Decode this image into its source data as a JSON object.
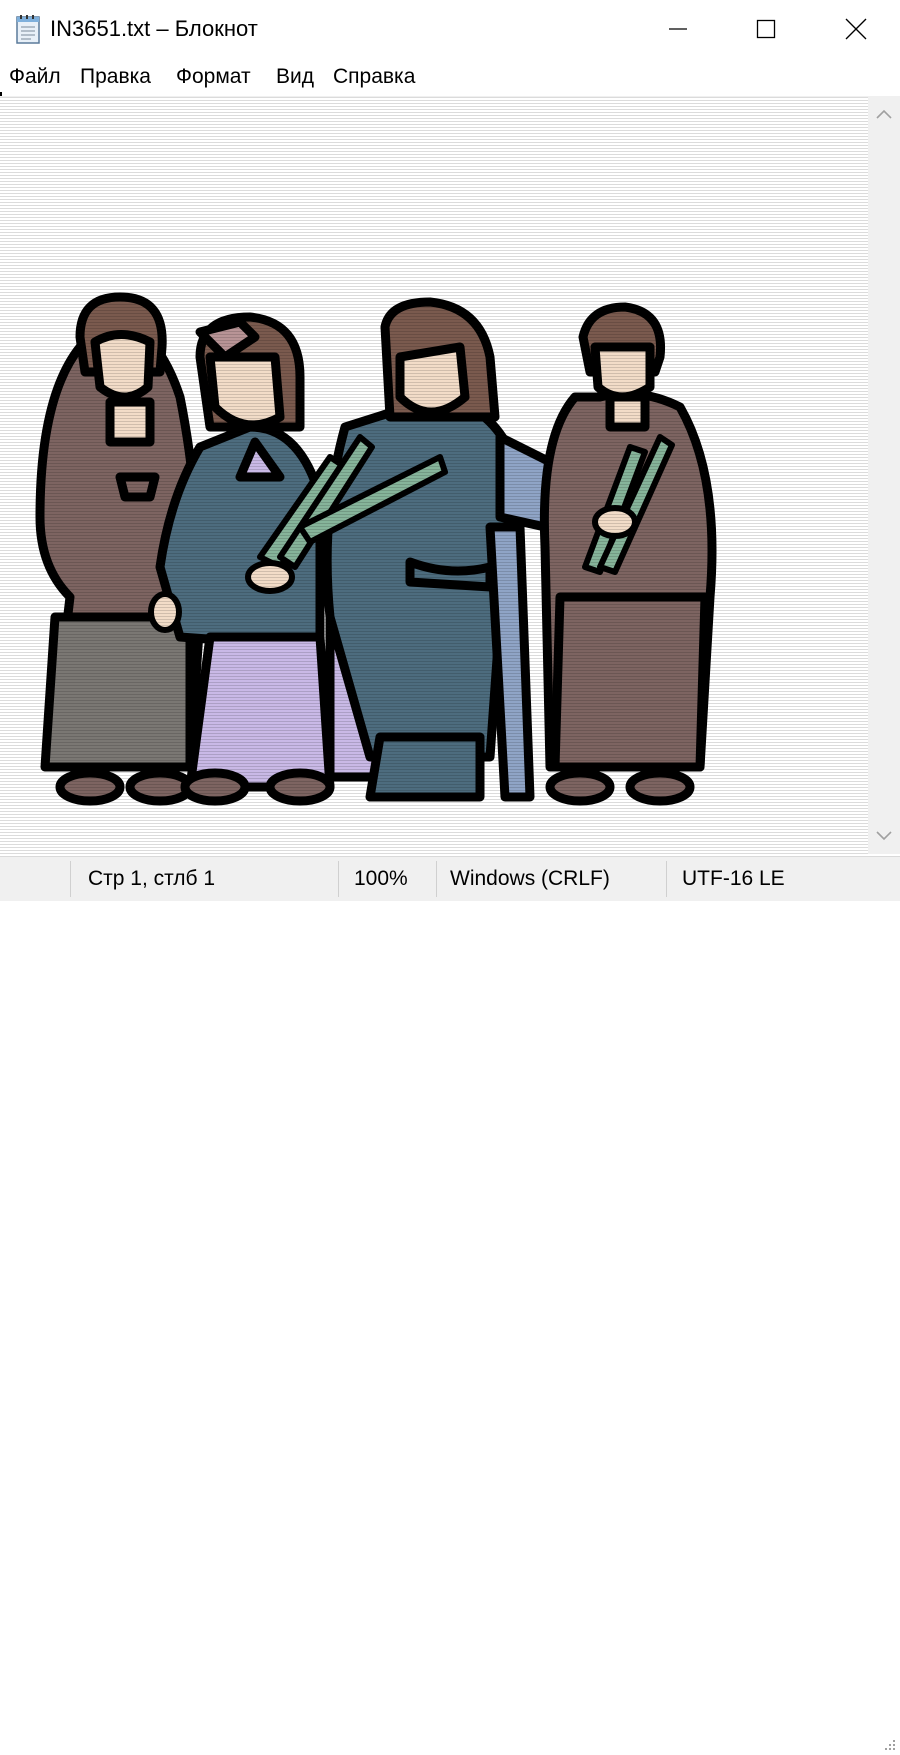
{
  "window": {
    "title": "IN3651.txt – Блокнот",
    "controls": {
      "minimize": "minimize",
      "maximize": "maximize",
      "close": "close"
    }
  },
  "menu": {
    "items": [
      "Файл",
      "Правка",
      "Формат",
      "Вид",
      "Справка"
    ]
  },
  "editor": {
    "content_type": "image",
    "image_subject": "clip-art of four women in robes, two holding green leek bundles",
    "colors": {
      "outline": "#000000",
      "skin": "#f2dcc8",
      "hair": "#7a5a4e",
      "robe_brown": "#7d6461",
      "robe_blue": "#4d6c7e",
      "robe_light_blue": "#8fa4c6",
      "skirt_lilac": "#c9b9e6",
      "pants_gray": "#7a7773",
      "leaves_green": "#86b49a",
      "bow_pink": "#b89496"
    }
  },
  "scrollbar": {
    "up_icon": "chevron-up-icon",
    "down_icon": "chevron-down-icon"
  },
  "statusbar": {
    "position": "Стр 1, стлб 1",
    "zoom": "100%",
    "line_endings": "Windows (CRLF)",
    "encoding": "UTF-16 LE"
  }
}
